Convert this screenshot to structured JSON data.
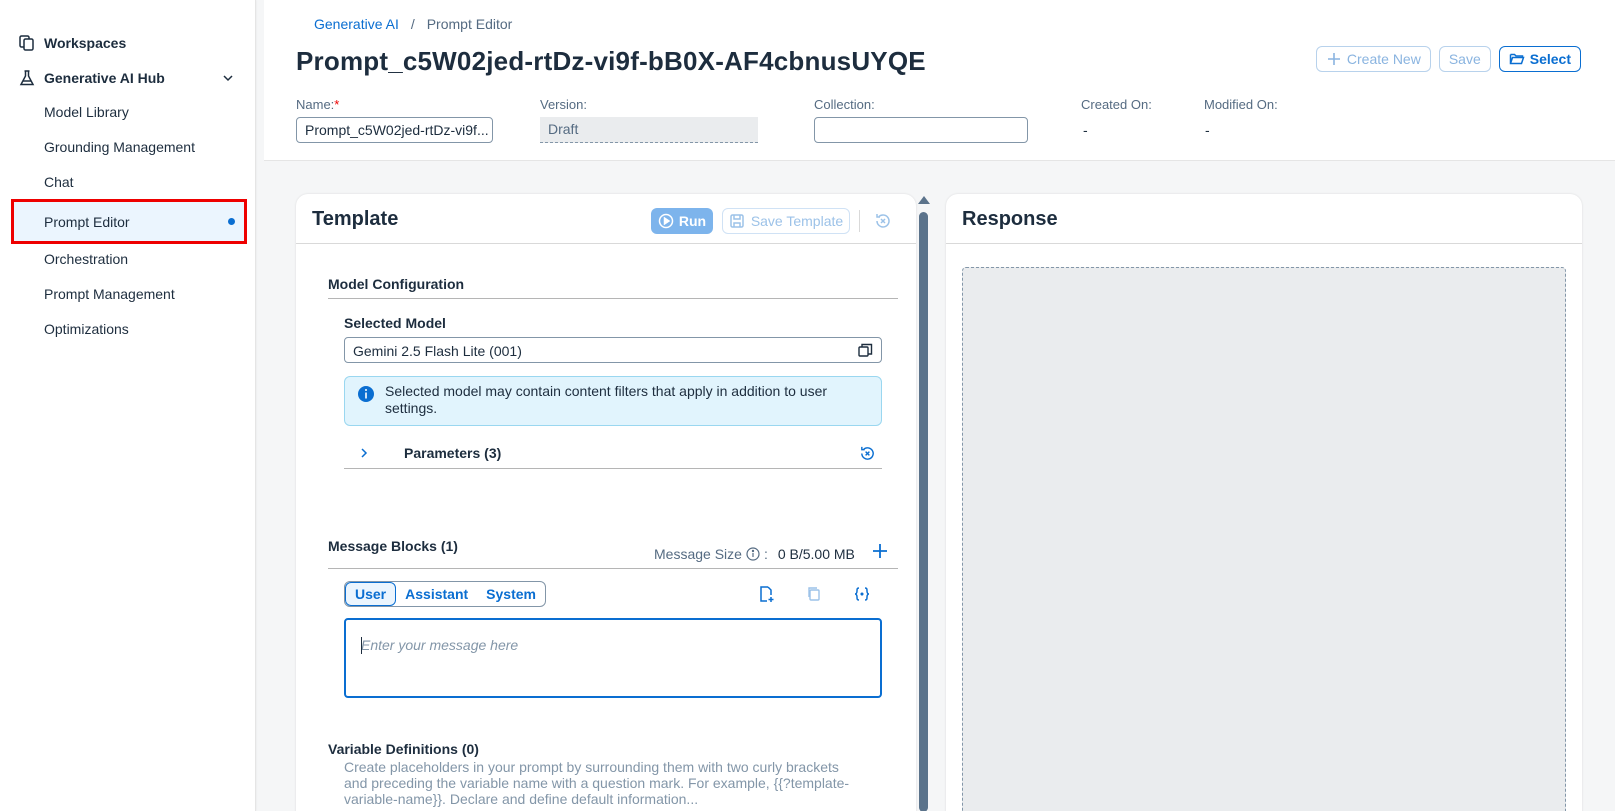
{
  "sidebar": {
    "workspaces": "Workspaces",
    "hub": "Generative AI Hub",
    "items": [
      {
        "label": "Model Library"
      },
      {
        "label": "Grounding Management"
      },
      {
        "label": "Chat"
      },
      {
        "label": "Prompt Editor"
      },
      {
        "label": "Orchestration"
      },
      {
        "label": "Prompt Management"
      },
      {
        "label": "Optimizations"
      }
    ]
  },
  "header": {
    "breadcrumb": {
      "parent": "Generative AI",
      "sep": "/",
      "current": "Prompt Editor"
    },
    "title": "Prompt_c5W02jed-rtDz-vi9f-bB0X-AF4cbnusUYQE",
    "buttons": {
      "create_new": "Create New",
      "save": "Save",
      "select": "Select"
    },
    "fields": {
      "name_label": "Name:",
      "name_required": "*",
      "name_value": "Prompt_c5W02jed-rtDz-vi9f...",
      "version_label": "Version:",
      "version_value": "Draft",
      "collection_label": "Collection:",
      "collection_value": "",
      "created_label": "Created On:",
      "created_value": "-",
      "modified_label": "Modified On:",
      "modified_value": "-"
    }
  },
  "template": {
    "title": "Template",
    "run": "Run",
    "save_template": "Save Template",
    "model_config": "Model Configuration",
    "selected_model_label": "Selected Model",
    "selected_model_value": "Gemini 2.5 Flash Lite (001)",
    "info_message": "Selected model may contain content filters that apply in addition to user settings.",
    "parameters": "Parameters (3)",
    "message_blocks": "Message Blocks (1)",
    "message_size_label": "Message Size",
    "message_size_sep": ":",
    "message_size_value": "0 B/5.00 MB",
    "roles": {
      "user": "User",
      "assistant": "Assistant",
      "system": "System"
    },
    "message_placeholder": "Enter your message here",
    "variable_definitions": "Variable Definitions (0)",
    "variable_desc": "Create placeholders in your prompt by surrounding them with two curly brackets and preceding the variable name with a question mark. For example, {{?template-variable-name}}. Declare and define default information..."
  },
  "response": {
    "title": "Response"
  }
}
